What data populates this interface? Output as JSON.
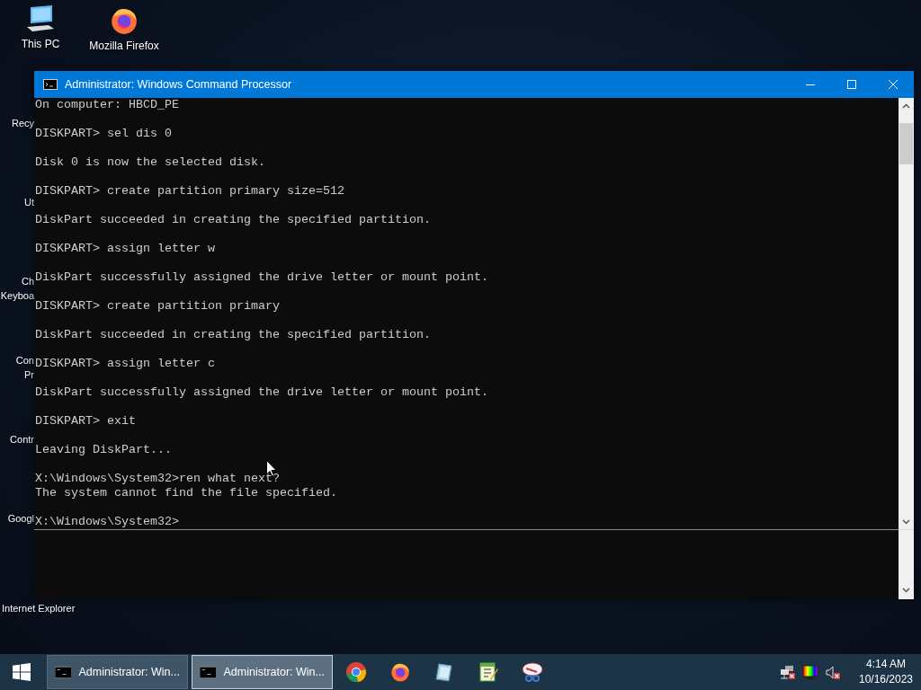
{
  "desktop": {
    "icons": [
      {
        "kind": "computer",
        "label": "This PC"
      },
      {
        "kind": "firefox",
        "label": "Mozilla Firefox"
      }
    ],
    "partial_labels": [
      {
        "lines": [
          "Recy"
        ]
      },
      {
        "lines": [
          "Ut"
        ]
      },
      {
        "lines": [
          "Ch",
          "Keyboa"
        ]
      },
      {
        "lines": [
          "Con",
          "Pr"
        ]
      },
      {
        "lines": [
          "Contr"
        ]
      },
      {
        "lines": [
          "Googl"
        ]
      },
      {
        "lines": [
          "Internet Explorer"
        ]
      }
    ]
  },
  "window": {
    "title": "Administrator: Windows Command Processor",
    "console": {
      "blocks": [
        [
          "On computer: HBCD_PE"
        ],
        [
          "DISKPART> sel dis 0"
        ],
        [
          "Disk 0 is now the selected disk."
        ],
        [
          "DISKPART> create partition primary size=512"
        ],
        [
          "DiskPart succeeded in creating the specified partition."
        ],
        [
          "DISKPART> assign letter w"
        ],
        [
          "DiskPart successfully assigned the drive letter or mount point."
        ],
        [
          "DISKPART> create partition primary"
        ],
        [
          "DiskPart succeeded in creating the specified partition."
        ],
        [
          "DISKPART> assign letter c"
        ],
        [
          "DiskPart successfully assigned the drive letter or mount point."
        ],
        [
          "DISKPART> exit"
        ],
        [
          "Leaving DiskPart..."
        ],
        [
          "X:\\Windows\\System32>ren what next?",
          "The system cannot find the file specified."
        ],
        [
          "X:\\Windows\\System32>"
        ]
      ]
    }
  },
  "taskbar": {
    "tasks": [
      {
        "label": "Administrator: Win...",
        "selected": false
      },
      {
        "label": "Administrator: Win...",
        "selected": true
      }
    ],
    "pinned": [
      {
        "kind": "chrome"
      },
      {
        "kind": "firefox"
      },
      {
        "kind": "notepad"
      },
      {
        "kind": "editor"
      },
      {
        "kind": "snipping"
      }
    ],
    "tray": [
      {
        "kind": "network",
        "error": true
      },
      {
        "kind": "display",
        "error": false
      },
      {
        "kind": "volume",
        "error": true
      }
    ],
    "clock": {
      "time": "4:14 AM",
      "date": "10/16/2023"
    }
  }
}
